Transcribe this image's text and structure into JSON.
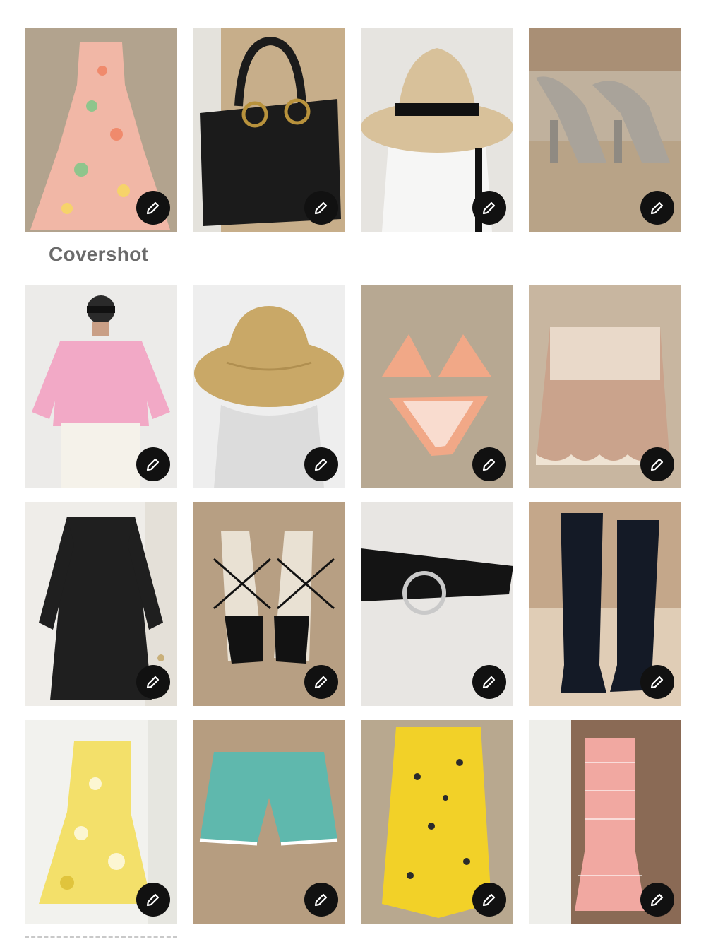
{
  "cover_label": "Covershot",
  "edit_icon": "pencil-icon",
  "items": [
    {
      "name": "floral-maxi-dress",
      "colors": {
        "bg": "#b6a793",
        "main": "#f1b7a6",
        "accent": "#8fc58c"
      }
    },
    {
      "name": "black-leather-handbag",
      "colors": {
        "bg": "#c7ae8a",
        "main": "#1b1b1b",
        "accent": "#b8923c"
      }
    },
    {
      "name": "straw-fedora-hat",
      "colors": {
        "bg": "#e6e4e0",
        "main": "#d8c19a",
        "accent": "#111111"
      }
    },
    {
      "name": "silver-platform-sandals",
      "colors": {
        "bg": "#c0b19d",
        "main": "#a9a39a",
        "accent": "#b8a387"
      }
    },
    {
      "name": "pink-linen-shirt",
      "colors": {
        "bg": "#ecebe9",
        "main": "#f2a9c6",
        "accent": "#f5f2ea"
      }
    },
    {
      "name": "wide-brim-straw-hat",
      "colors": {
        "bg": "#eeeeee",
        "main": "#c9a867",
        "accent": "#dcdcdc"
      }
    },
    {
      "name": "peach-bikini",
      "colors": {
        "bg": "#b7a892",
        "main": "#f1a887",
        "accent": "#ffffff"
      }
    },
    {
      "name": "lace-cami-top",
      "colors": {
        "bg": "#c8b6a0",
        "main": "#caa38c",
        "accent": "#efe3d3"
      }
    },
    {
      "name": "black-wool-coat",
      "colors": {
        "bg": "#efede9",
        "main": "#1f1f1f",
        "accent": "#c9b07a"
      }
    },
    {
      "name": "black-strappy-heels",
      "colors": {
        "bg": "#b79f83",
        "main": "#121212",
        "accent": "#e9e1d3"
      }
    },
    {
      "name": "black-ring-belt",
      "colors": {
        "bg": "#e8e6e3",
        "main": "#141414",
        "accent": "#c9c9c9"
      }
    },
    {
      "name": "black-suede-boots",
      "colors": {
        "bg": "#c4a78a",
        "main": "#141a26",
        "accent": "#e0cdb6"
      }
    },
    {
      "name": "yellow-floral-dress",
      "colors": {
        "bg": "#f2f2ee",
        "main": "#f3e06a",
        "accent": "#ffffff"
      }
    },
    {
      "name": "teal-crochet-shorts",
      "colors": {
        "bg": "#b69d80",
        "main": "#5fb8ad",
        "accent": "#ffffff"
      }
    },
    {
      "name": "yellow-ruched-skirt",
      "colors": {
        "bg": "#b8a88f",
        "main": "#f2d128",
        "accent": "#2b2b2b"
      }
    },
    {
      "name": "pink-gingham-dress",
      "colors": {
        "bg": "#8a6a55",
        "main": "#f1a8a1",
        "accent": "#ffffff"
      }
    }
  ]
}
